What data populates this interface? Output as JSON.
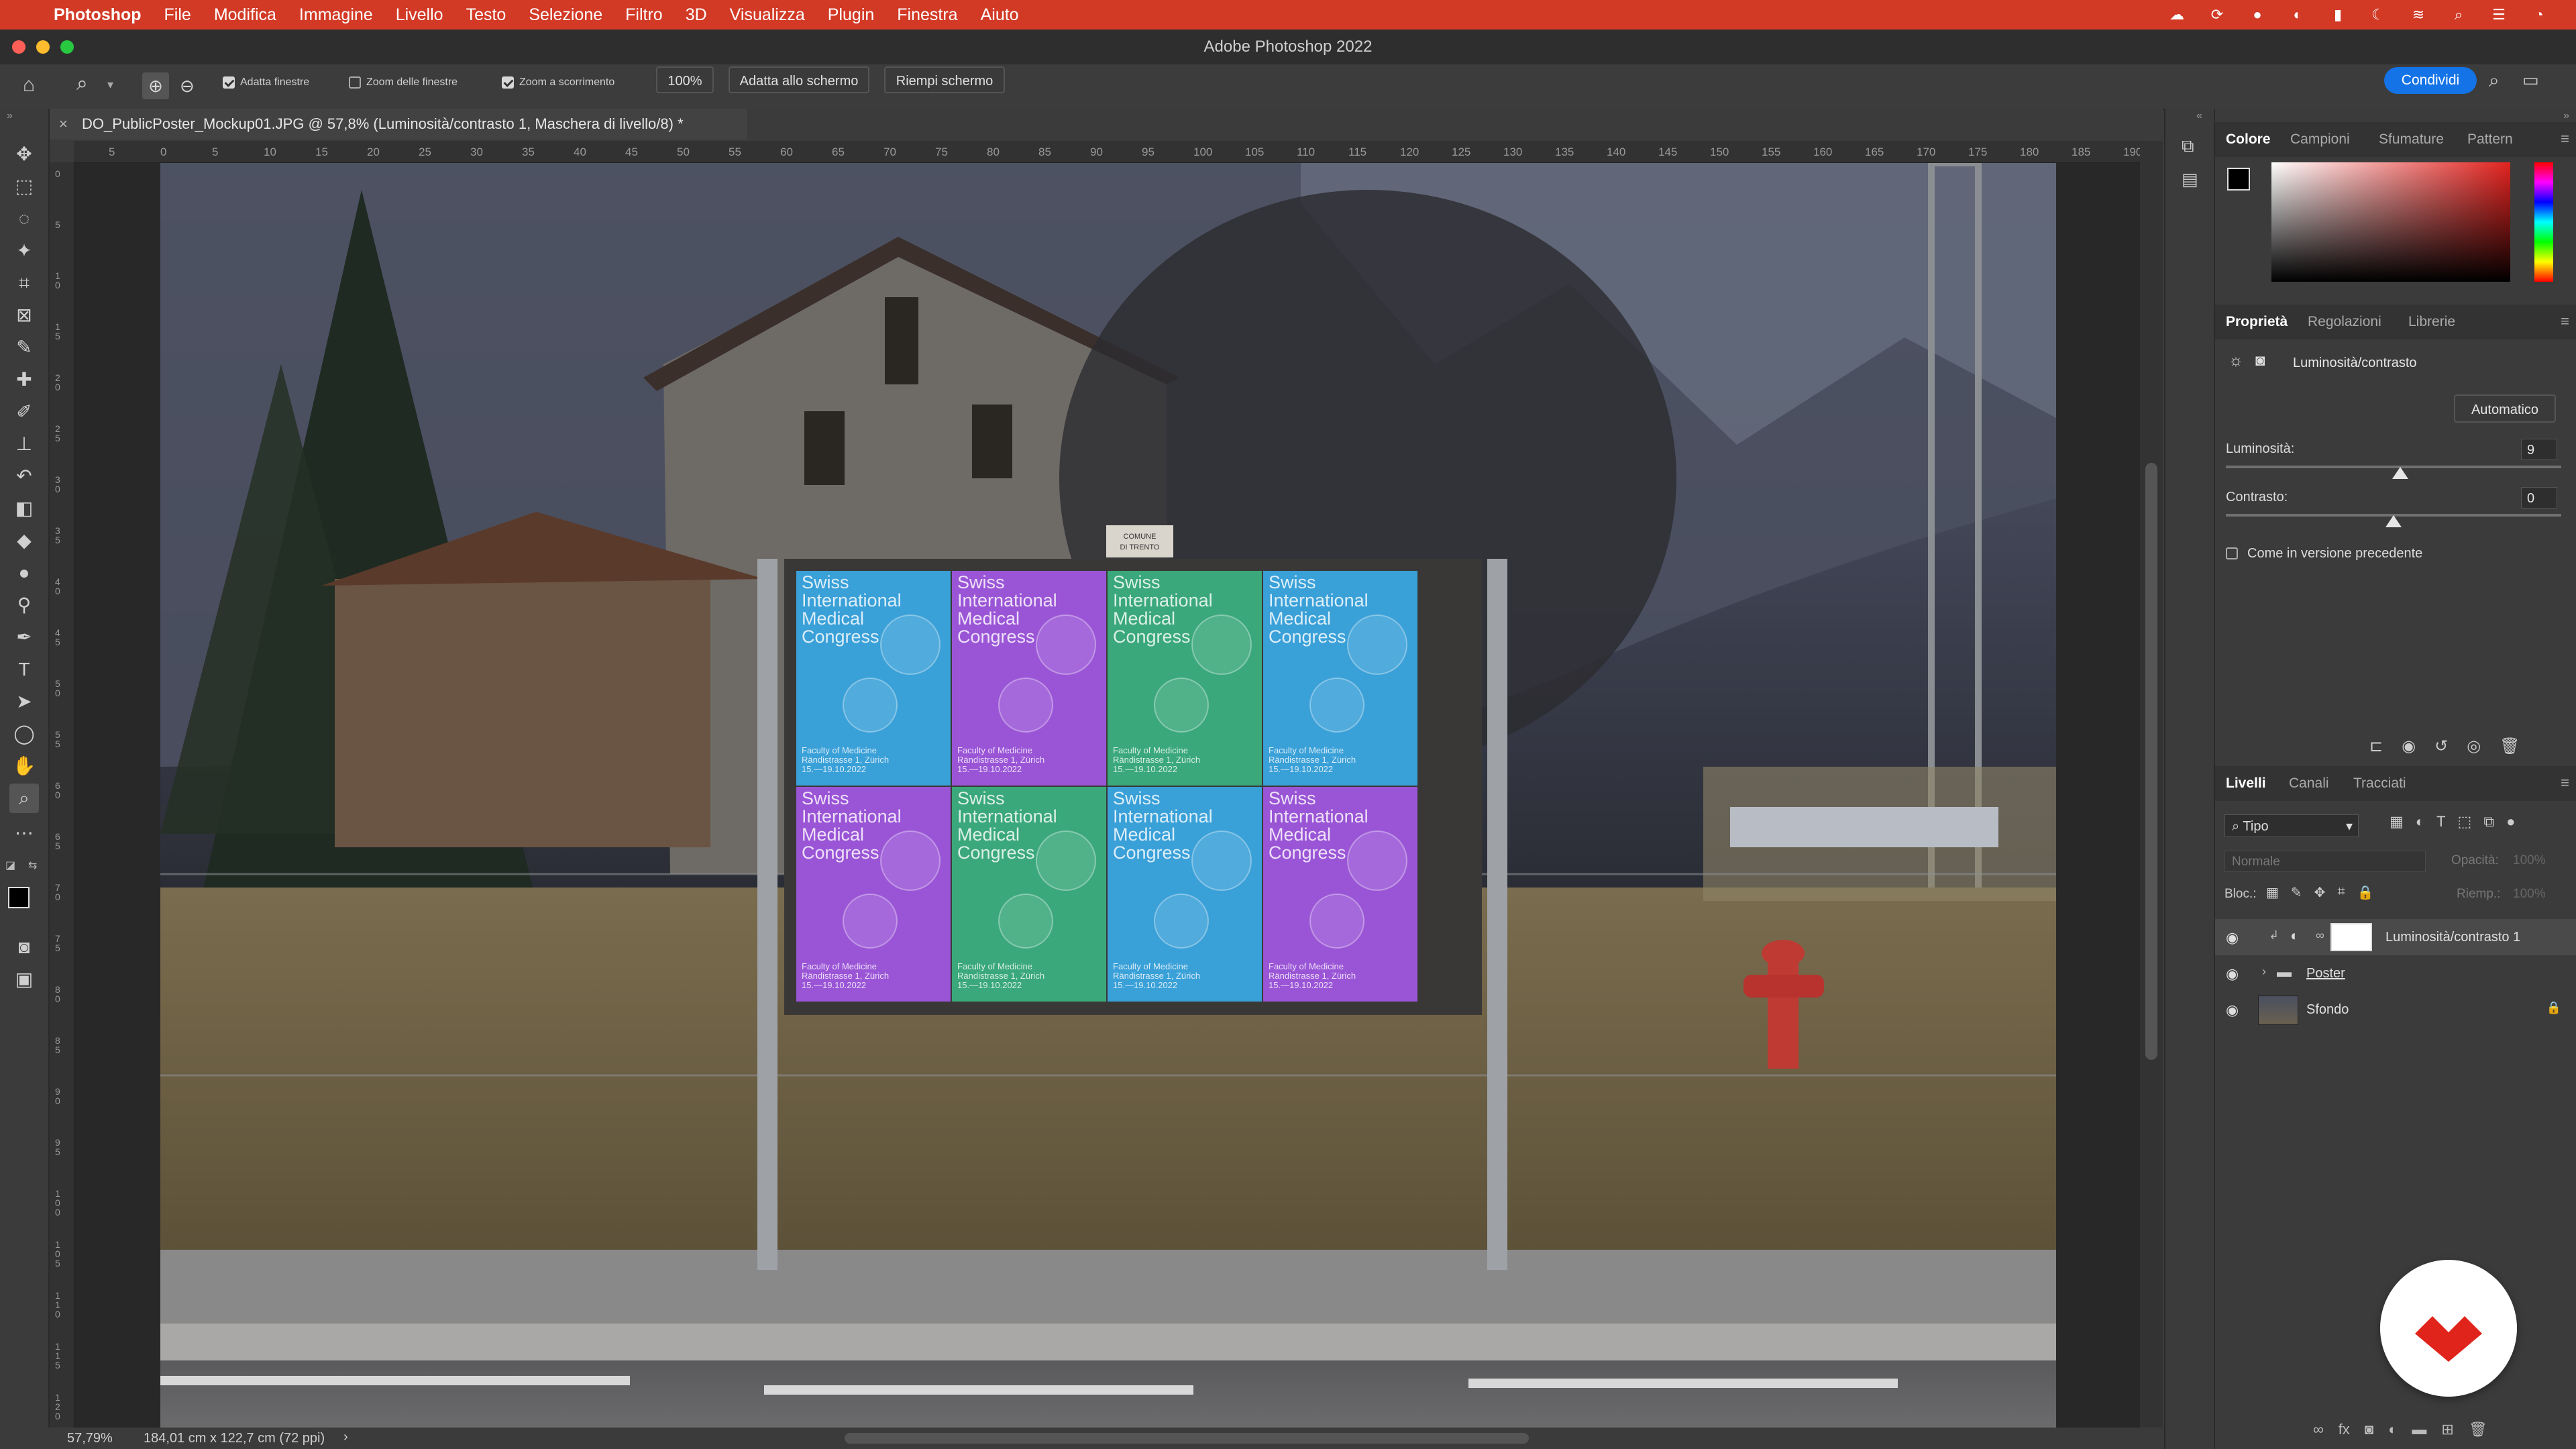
{
  "menubar": {
    "app_name": "Photoshop",
    "items": [
      "File",
      "Modifica",
      "Immagine",
      "Livello",
      "Testo",
      "Selezione",
      "Filtro",
      "3D",
      "Visualizza",
      "Plugin",
      "Finestra",
      "Aiuto"
    ]
  },
  "window": {
    "title": "Adobe Photoshop 2022"
  },
  "options": {
    "fit_windows": "Adatta finestre",
    "zoom_all": "Zoom delle finestre",
    "scrubby_zoom": "Zoom a scorrimento",
    "zoom_value": "100%",
    "fit_screen": "Adatta allo schermo",
    "fill_screen": "Riempi schermo",
    "share": "Condividi"
  },
  "document": {
    "tab_title": "DO_PublicPoster_Mockup01.JPG @ 57,8% (Luminosità/contrasto 1, Maschera di livello/8) *",
    "zoom": "57,79%",
    "dimensions": "184,01 cm x 122,7 cm (72 ppi)"
  },
  "rulers": {
    "h": [
      "5",
      "0",
      "5",
      "10",
      "15",
      "20",
      "25",
      "30",
      "35",
      "40",
      "45",
      "50",
      "55",
      "60",
      "65",
      "70",
      "75",
      "80",
      "85",
      "90",
      "95",
      "100",
      "105",
      "110",
      "115",
      "120",
      "125",
      "130",
      "135",
      "140",
      "145",
      "150",
      "155",
      "160",
      "165",
      "170",
      "175",
      "180",
      "185",
      "190"
    ],
    "v": [
      "0",
      "5",
      "1 0",
      "1 5",
      "2 0",
      "2 5",
      "3 0",
      "3 5",
      "4 0",
      "4 5",
      "5 0",
      "5 5",
      "6 0",
      "6 5",
      "7 0",
      "7 5",
      "8 0",
      "8 5",
      "9 0",
      "9 5",
      "1 0 0",
      "1 0 5",
      "1 1 0",
      "1 1 5",
      "1 2 0"
    ]
  },
  "poster": {
    "title_lines": [
      "Swiss",
      "International",
      "Medical",
      "Congress"
    ],
    "footer_lines": [
      "Faculty of Medicine",
      "Rändistrasse 1, Zürich",
      "15.—19.10.2022"
    ],
    "sign": [
      "COMUNE",
      "DI TRENTO"
    ],
    "colors": [
      "#3aa0d8",
      "#9a55d6",
      "#3aa87a",
      "#3aa0d8",
      "#9a55d6",
      "#3aa87a",
      "#3aa0d8",
      "#9a55d6"
    ]
  },
  "color_panel": {
    "tabs": [
      "Colore",
      "Campioni",
      "Sfumature",
      "Pattern"
    ]
  },
  "properties_panel": {
    "tabs": [
      "Proprietà",
      "Regolazioni",
      "Librerie"
    ],
    "adjustment_name": "Luminosità/contrasto",
    "auto_button": "Automatico",
    "brightness_label": "Luminosità:",
    "brightness_value": "9",
    "brightness_level": 0.52,
    "contrast_label": "Contrasto:",
    "contrast_value": "0",
    "contrast_level": 0.5,
    "legacy_label": "Come in versione precedente"
  },
  "layers_panel": {
    "tabs": [
      "Livelli",
      "Canali",
      "Tracciati"
    ],
    "filter_label": "Tipo",
    "blend_mode": "Normale",
    "opacity_label": "Opacità:",
    "opacity_value": "100%",
    "lock_label": "Bloc.:",
    "fill_label": "Riemp.:",
    "fill_value": "100%",
    "layers": [
      {
        "name": "Luminosità/contrasto 1"
      },
      {
        "name": "Poster"
      },
      {
        "name": "Sfondo"
      }
    ]
  },
  "colors": {
    "menubar": "#d23a26",
    "accent": "#1473e6",
    "brand_badge": "#e0241b"
  }
}
